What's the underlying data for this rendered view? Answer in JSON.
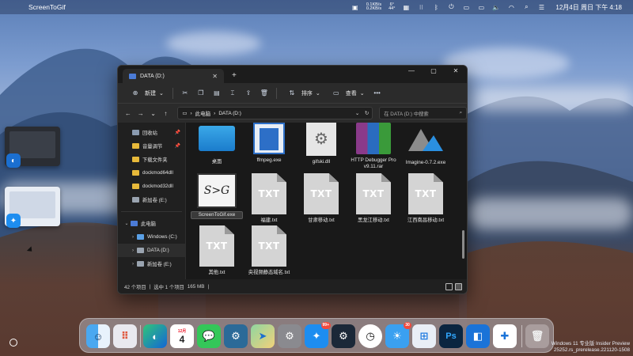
{
  "menubar": {
    "app_name": "ScreenToGif",
    "net_up": "0.1KB/s",
    "net_down": "0.2KB/s",
    "temp_top": "6°",
    "temp_bottom": "44°",
    "clock": "12月4日 周日 下午 4:18"
  },
  "explorer": {
    "tab_title": "DATA (D:)",
    "toolbar": {
      "new_label": "新建",
      "sort_label": "排序",
      "view_label": "查看"
    },
    "address": {
      "root": "此电脑",
      "current": "DATA (D:)"
    },
    "search_placeholder": "在 DATA (D:) 中搜索",
    "sidebar": {
      "quick": [
        {
          "label": "回收站",
          "color": "#8a9bb0"
        },
        {
          "label": "音量调节",
          "color": "#e7b93a"
        },
        {
          "label": "下载文件夹",
          "color": "#e7b93a"
        },
        {
          "label": "dockmod64dll",
          "color": "#e7b93a"
        },
        {
          "label": "dockmod32dll",
          "color": "#e7b93a"
        },
        {
          "label": "新加卷 (E:)",
          "color": "#9aa4b0"
        }
      ],
      "pc_label": "此电脑",
      "drives": [
        {
          "label": "Windows (C:)"
        },
        {
          "label": "DATA (D:)"
        },
        {
          "label": "新加卷 (E:)"
        }
      ]
    },
    "files": {
      "f1": "桌面",
      "f2": "ffmpeg.exe",
      "f3": "gifski.dll",
      "f4": "HTTP Debugger Pro v9.11.rar",
      "f5": "Imagine-0.7.2.exe",
      "f6": "ScreenToGif.exe",
      "f7": "福建.txt",
      "f8": "甘肃移动.txt",
      "f9": "黑龙江移动.txt",
      "f10": "江西南昌移动.txt",
      "f11": "其他.txt",
      "f12": "央视频静态域名.txt",
      "txt_label": "TXT",
      "stg_label": "S>G"
    },
    "status": {
      "count": "42 个项目",
      "selected": "选中 1 个项目",
      "size": "165 MB"
    }
  },
  "dock": {
    "calendar_month": "12月",
    "calendar_day": "4",
    "badge_appstore": "99+",
    "badge_weather": "30"
  },
  "watermark": {
    "line1": "Windows 11 专业版 Insider Preview",
    "line2": "25252.rs_prerelease.221120-1508"
  }
}
